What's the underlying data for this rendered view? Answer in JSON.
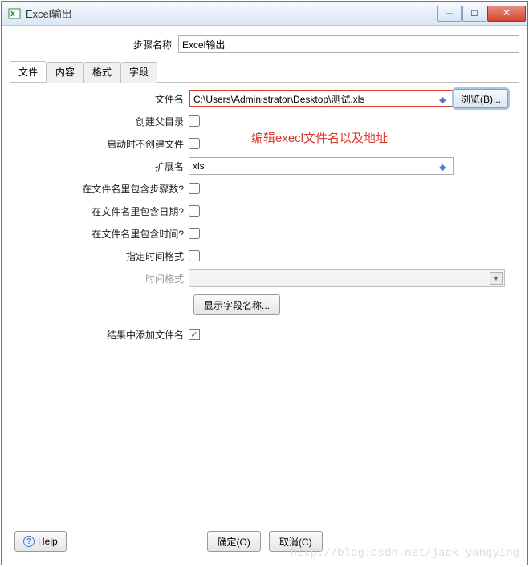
{
  "titlebar": {
    "title": "Excel输出"
  },
  "step": {
    "label": "步骤名称",
    "value": "Excel输出"
  },
  "tabs": {
    "file": "文件",
    "content": "内容",
    "format": "格式",
    "fields": "字段"
  },
  "form": {
    "filename_label": "文件名",
    "filename_value": "C:\\Users\\Administrator\\Desktop\\测试.xls",
    "browse_label": "浏览(B)...",
    "create_parent_label": "创建父目录",
    "no_create_on_start_label": "启动时不创建文件",
    "extension_label": "扩展名",
    "extension_value": "xls",
    "include_stepnr_label": "在文件名里包含步骤数?",
    "include_date_label": "在文件名里包含日期?",
    "include_time_label": "在文件名里包含时间?",
    "specify_timefmt_label": "指定时间格式",
    "time_format_label": "时间格式",
    "show_fieldnames_label": "显示字段名称...",
    "add_filename_result_label": "结果中添加文件名"
  },
  "annotation": "编辑execl文件名以及地址",
  "buttons": {
    "ok": "确定(O)",
    "cancel": "取消(C)",
    "help": "Help"
  },
  "watermark": "http://blog.csdn.net/jack_yangying"
}
